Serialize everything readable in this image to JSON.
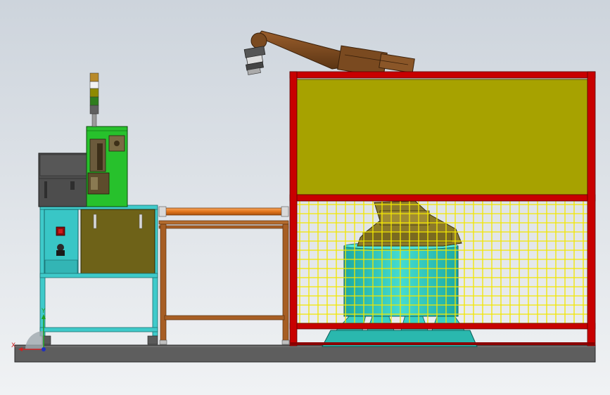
{
  "view": {
    "background_top": "#cdd4dc",
    "background_bottom": "#f0f2f4"
  },
  "colors": {
    "floor": "#5e5e5e",
    "frame_red": "#c80000",
    "panel_yellow": "#a7a200",
    "mesh_yellow": "#f2e600",
    "cabinet_teal": "#39c6c6",
    "cabinet_olive": "#6e6218",
    "machine_green": "#27c12c",
    "machine_gray": "#4d4d4d",
    "conveyor_orange": "#e2761c",
    "bench_brown": "#a75e24",
    "robot_brown": "#7a4a20",
    "robot_base_cyan": "#38cfc4"
  },
  "components": [
    "floor-base",
    "control-cabinet",
    "green-processing-machine",
    "signal-tower-light",
    "conveyor-bench",
    "safety-fence-cell",
    "industrial-robot"
  ],
  "signal_tower": [
    "#b88a2a",
    "#f2f2f2",
    "#8f8a00",
    "#2f7d1e",
    "#606060"
  ],
  "triad": {
    "x_label": "X",
    "y_label": "Y"
  }
}
